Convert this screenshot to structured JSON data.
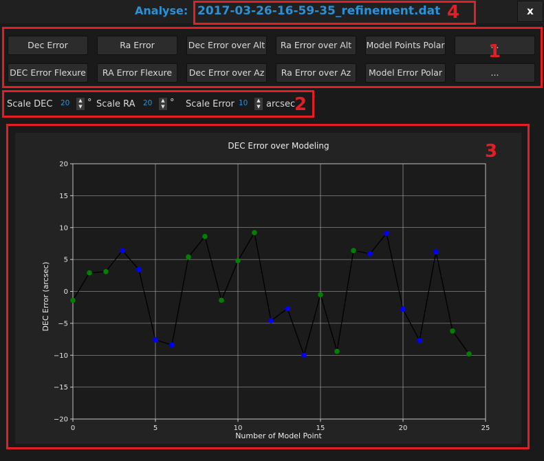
{
  "window": {
    "title_label": "Analyse:",
    "filename": "2017-03-26-16-59-35_refinement.dat",
    "close_label": "x"
  },
  "callouts": [
    "1",
    "2",
    "3",
    "4"
  ],
  "buttons": {
    "row1": [
      "Dec Error",
      "Ra Error",
      "Dec Error over Alt",
      "Ra Error over Alt",
      "Model Points Polar",
      "..."
    ],
    "row2": [
      "DEC Error Flexure",
      "RA Error Flexure",
      "Dec Error over Az",
      "Ra Error over Az",
      "Model Error Polar",
      "..."
    ]
  },
  "scale": {
    "dec_label": "Scale DEC",
    "dec_value": "20",
    "dec_unit": "°",
    "ra_label": "Scale RA",
    "ra_value": "20",
    "ra_unit": "°",
    "err_label": "Scale Error",
    "err_value": "10",
    "err_unit": "arcsec"
  },
  "spinner_icons": {
    "up": "▲",
    "down": "▼"
  },
  "chart_data": {
    "type": "line",
    "title": "DEC Error over Modeling",
    "xlabel": "Number of Model Point",
    "ylabel": "DEC Error (arcsec)",
    "xlim": [
      0,
      25
    ],
    "ylim": [
      -20,
      20
    ],
    "xticks": [
      0,
      5,
      10,
      15,
      20,
      25
    ],
    "yticks": [
      -20,
      -15,
      -10,
      -5,
      0,
      5,
      10,
      15,
      20
    ],
    "grid": true,
    "x": [
      0,
      1,
      2,
      3,
      4,
      5,
      6,
      7,
      8,
      9,
      10,
      11,
      12,
      13,
      14,
      15,
      16,
      17,
      18,
      19,
      20,
      21,
      22,
      23,
      24
    ],
    "y": [
      -1.4,
      2.9,
      3.1,
      6.4,
      3.4,
      -7.6,
      -8.4,
      5.4,
      8.6,
      -1.4,
      4.8,
      9.2,
      -4.6,
      -2.7,
      -10.0,
      -0.5,
      -9.4,
      6.4,
      5.9,
      9.1,
      -2.8,
      -7.7,
      6.2,
      -6.2,
      -9.8
    ],
    "point_colors": [
      "#008000",
      "#008000",
      "#008000",
      "#0000ff",
      "#0000ff",
      "#0000ff",
      "#0000ff",
      "#008000",
      "#008000",
      "#008000",
      "#008000",
      "#008000",
      "#0000ff",
      "#0000ff",
      "#0000ff",
      "#008000",
      "#008000",
      "#008000",
      "#0000ff",
      "#0000ff",
      "#0000ff",
      "#0000ff",
      "#0000ff",
      "#008000",
      "#008000"
    ],
    "line_color": "#000000"
  },
  "colors": {
    "accent": "#2b91d6",
    "callout": "#e31e24",
    "plot_bg": "#1b1b1b",
    "grid": "#b8b8b8"
  }
}
